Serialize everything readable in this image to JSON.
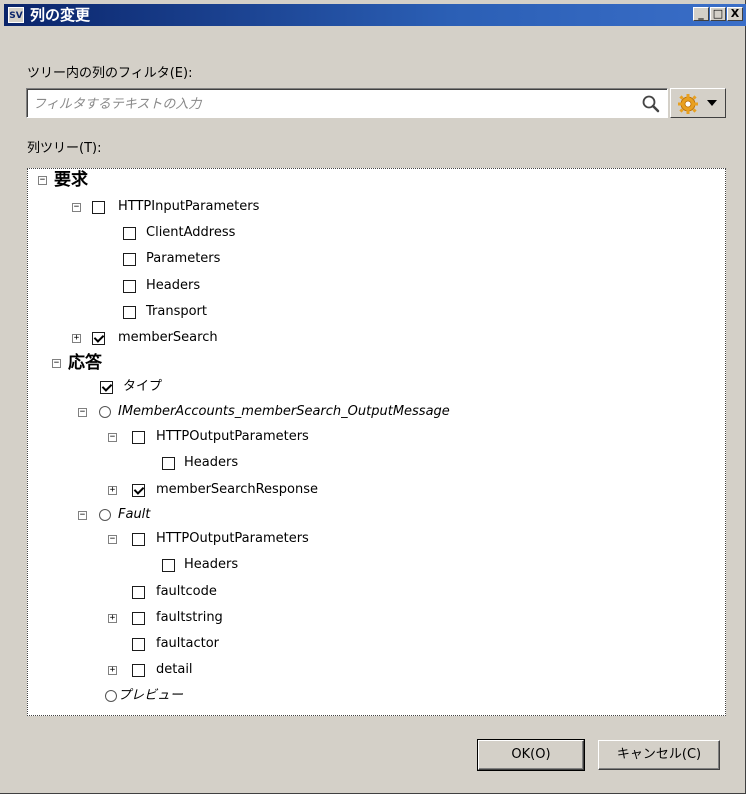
{
  "window": {
    "title": "列の変更",
    "icon_text": "SV",
    "minimize": "_",
    "maximize": "□",
    "close": "X"
  },
  "filter": {
    "label": "ツリー内の列のフィルタ(E):",
    "placeholder": "フィルタするテキストの入力",
    "value": ""
  },
  "tree_label": "列ツリー(T):",
  "tree": [
    {
      "text": "要求",
      "bold": true,
      "expander": "minus",
      "control": "none"
    },
    {
      "text": "HTTPInputParameters",
      "expander": "minus",
      "control": "checkbox",
      "checked": false
    },
    {
      "text": "ClientAddress",
      "expander": "none",
      "control": "checkbox",
      "checked": false
    },
    {
      "text": "Parameters",
      "expander": "none",
      "control": "checkbox",
      "checked": false
    },
    {
      "text": "Headers",
      "expander": "none",
      "control": "checkbox",
      "checked": false
    },
    {
      "text": "Transport",
      "expander": "none",
      "control": "checkbox",
      "checked": false
    },
    {
      "text": "memberSearch",
      "expander": "plus",
      "control": "checkbox",
      "checked": true
    },
    {
      "text": "応答",
      "bold": true,
      "expander": "minus",
      "control": "none"
    },
    {
      "text": "タイプ",
      "expander": "none",
      "control": "checkbox",
      "checked": true
    },
    {
      "text": "IMemberAccounts_memberSearch_OutputMessage",
      "italic": true,
      "expander": "minus",
      "control": "radio"
    },
    {
      "text": "HTTPOutputParameters",
      "expander": "minus",
      "control": "checkbox",
      "checked": false
    },
    {
      "text": "Headers",
      "expander": "none",
      "control": "checkbox",
      "checked": false
    },
    {
      "text": "memberSearchResponse",
      "expander": "plus",
      "control": "checkbox",
      "checked": true
    },
    {
      "text": "Fault",
      "italic": true,
      "expander": "minus",
      "control": "radio"
    },
    {
      "text": "HTTPOutputParameters",
      "expander": "minus",
      "control": "checkbox",
      "checked": false
    },
    {
      "text": "Headers",
      "expander": "none",
      "control": "checkbox",
      "checked": false
    },
    {
      "text": "faultcode",
      "expander": "none",
      "control": "checkbox",
      "checked": false
    },
    {
      "text": "faultstring",
      "expander": "plus",
      "control": "checkbox",
      "checked": false
    },
    {
      "text": "faultactor",
      "expander": "none",
      "control": "checkbox",
      "checked": false
    },
    {
      "text": "detail",
      "expander": "plus",
      "control": "checkbox",
      "checked": false
    },
    {
      "text": "プレビュー",
      "italic": true,
      "expander": "none",
      "control": "radio"
    }
  ],
  "buttons": {
    "ok": "OK(O)",
    "cancel": "キャンセル(C)"
  },
  "icons": {
    "search": "search-icon",
    "gear": "gear-icon",
    "dropdown": "chevron-down-icon"
  }
}
